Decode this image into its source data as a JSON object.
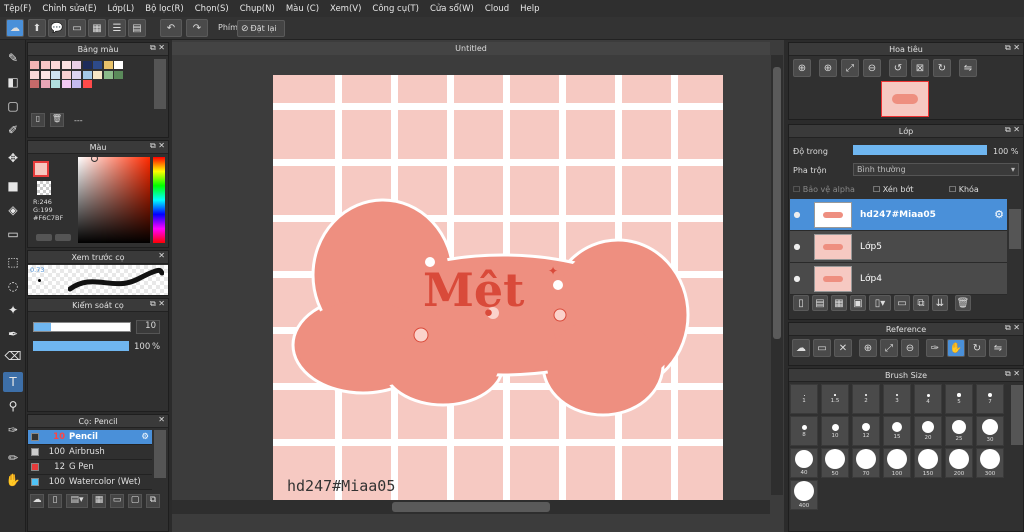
{
  "menu": [
    "Tệp(F)",
    "Chỉnh sửa(E)",
    "Lớp(L)",
    "Bộ lọc(R)",
    "Chọn(S)",
    "Chụp(N)",
    "Màu (C)",
    "Xem(V)",
    "Công cụ(T)",
    "Cửa sổ(W)",
    "Cloud",
    "Help"
  ],
  "toolbar": {
    "phim_label": "Phím",
    "reset_label": "Đặt lại"
  },
  "panels": {
    "palette": "Bảng màu",
    "palette_extra": "---",
    "color": "Màu",
    "rgb": "R:246",
    "g": "G:199",
    "b": "B:191",
    "hex": "#F6C7BF",
    "preview": "Xem trước cọ",
    "preview_size": "0.73",
    "brush_ctrl": "Kiểm soát cọ",
    "brush_size_val": "10",
    "opacity_val": "100",
    "opacity_unit": "%",
    "brush": "Cọ: Pencil",
    "navigator": "Hoa tiêu",
    "layer": "Lớp",
    "reference": "Reference",
    "brushsize": "Brush Size"
  },
  "brushes": [
    {
      "size": "10",
      "name": "Pencil",
      "color": "#333"
    },
    {
      "size": "100",
      "name": "Airbrush",
      "color": "#ccc"
    },
    {
      "size": "12",
      "name": "G Pen",
      "color": "#e63b3b"
    },
    {
      "size": "100",
      "name": "Watercolor (Wet)",
      "color": "#4fc3f7"
    }
  ],
  "doc_tab": "Untitled",
  "artwork": {
    "title": "Mệt",
    "signature": "hd247#Miaa05"
  },
  "layer_panel": {
    "opacity_label": "Độ trong",
    "opacity_val": "100 %",
    "blend_label": "Pha trộn",
    "blend_val": "Bình thường",
    "protect_alpha": "Bảo vệ alpha",
    "clipping": "Xén bớt",
    "lock": "Khóa"
  },
  "layers": [
    {
      "name": "hd247#Miaa05",
      "selected": true
    },
    {
      "name": "Lớp5",
      "selected": false
    },
    {
      "name": "Lớp4",
      "selected": false
    }
  ],
  "brush_sizes": [
    "1",
    "1.5",
    "2",
    "3",
    "4",
    "5",
    "7",
    "8",
    "10",
    "12",
    "15",
    "20",
    "25",
    "30",
    "40",
    "50",
    "70",
    "100",
    "150",
    "200",
    "300",
    "400"
  ]
}
